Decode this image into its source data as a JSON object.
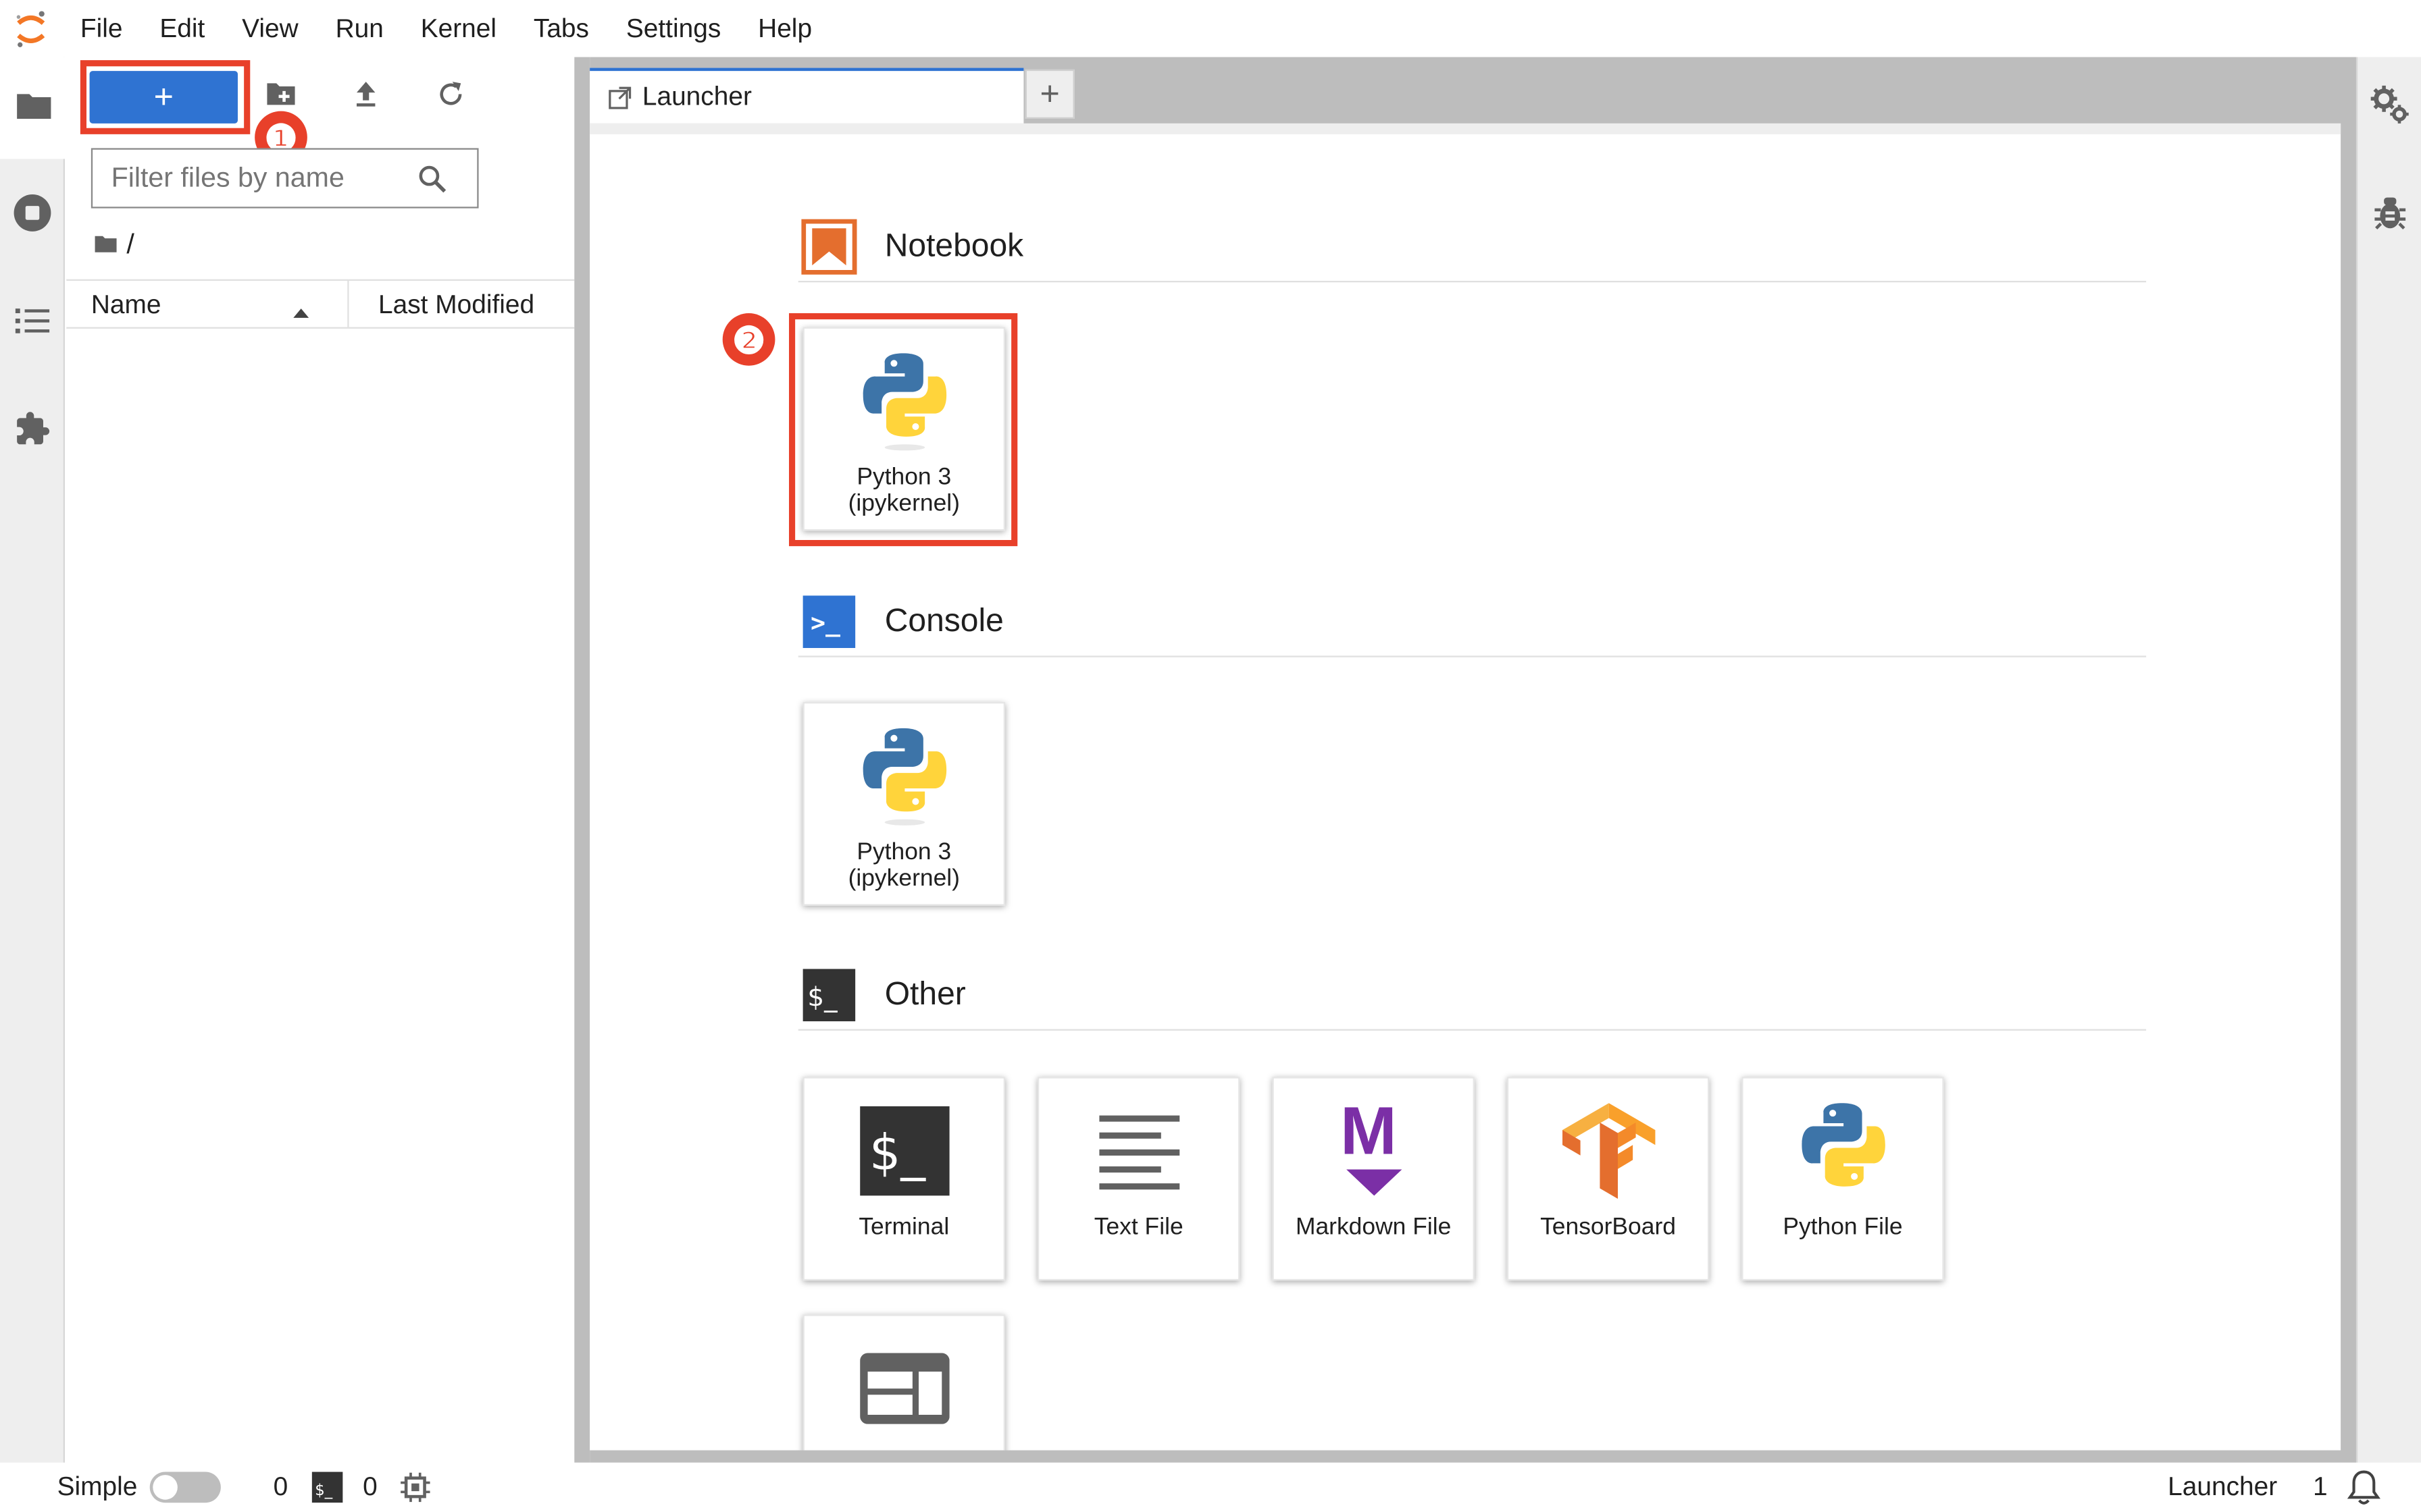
{
  "menubar": {
    "items": [
      "File",
      "Edit",
      "View",
      "Run",
      "Kernel",
      "Tabs",
      "Settings",
      "Help"
    ]
  },
  "leftbar": {
    "icons": [
      "folder-icon",
      "running-icon",
      "toc-icon",
      "extension-icon"
    ]
  },
  "filebrowser": {
    "new_button_label": "+",
    "filter_placeholder": "Filter files by name",
    "breadcrumb": "/",
    "columns": {
      "name": "Name",
      "last_modified": "Last Modified"
    },
    "badge_1": "❶"
  },
  "tabs": {
    "active": "Launcher",
    "add": "+"
  },
  "launcher": {
    "badge_2": "❷",
    "sections": {
      "notebook": {
        "title": "Notebook",
        "cards": [
          {
            "label": "Python 3\n(ipykernel)"
          }
        ]
      },
      "console": {
        "title": "Console",
        "cards": [
          {
            "label": "Python 3\n(ipykernel)"
          }
        ]
      },
      "other": {
        "title": "Other",
        "console_icon_text": ">_",
        "other_icon_text": "$_",
        "cards": [
          {
            "label": "Terminal",
            "icon_text": "$_"
          },
          {
            "label": "Text File"
          },
          {
            "label": "Markdown File",
            "icon_text": "M"
          },
          {
            "label": "TensorBoard"
          },
          {
            "label": "Python File"
          },
          {
            "label": ""
          }
        ]
      }
    }
  },
  "statusbar": {
    "mode": "Simple",
    "kernels": "0",
    "terminal_icon_text": "$_",
    "terminals": "0",
    "right_label": "Launcher",
    "notifications": "1"
  },
  "colors": {
    "accent": "#2f73d2",
    "highlight": "#e8402a",
    "notebook_orange": "#e46e2e"
  }
}
